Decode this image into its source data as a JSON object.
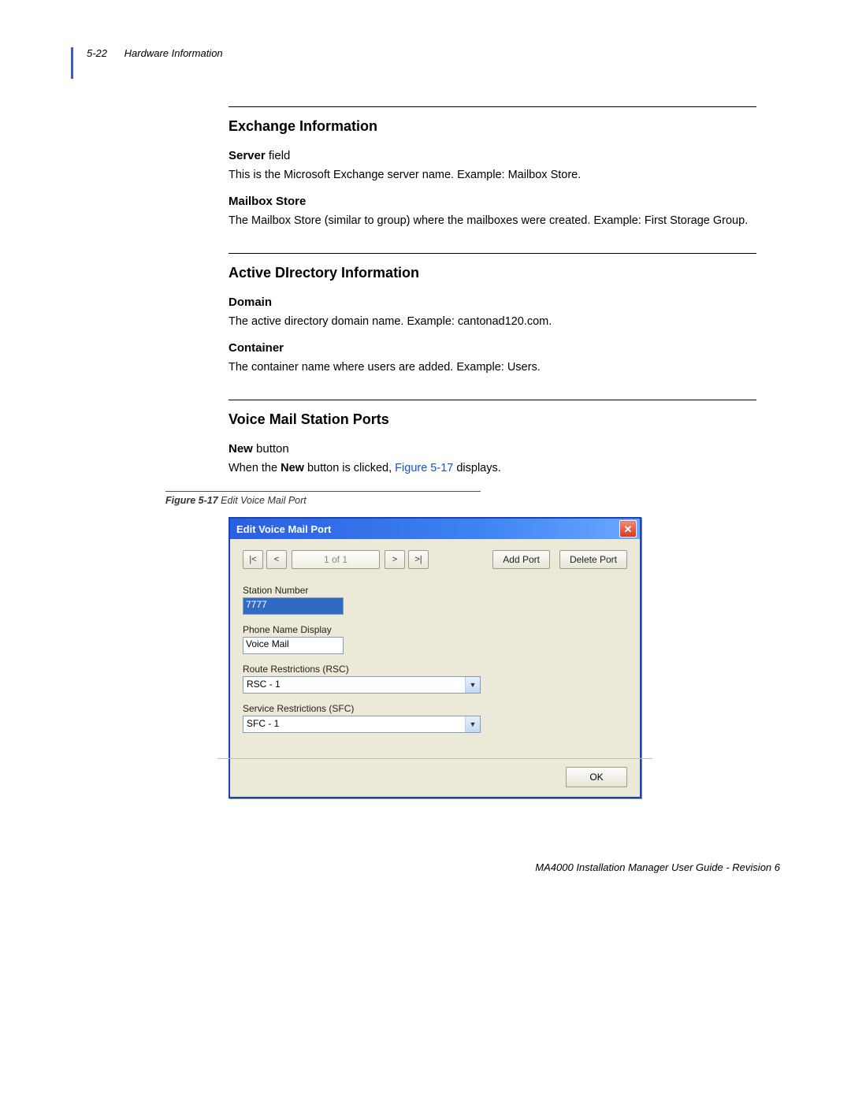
{
  "header": {
    "pageno": "5-22",
    "title": "Hardware Information"
  },
  "sections": {
    "exchange": {
      "title": "Exchange Information",
      "server_label": "Server",
      "server_suffix": " field",
      "server_desc": "This is the Microsoft Exchange server name. Example: Mailbox Store.",
      "mailbox_label": "Mailbox Store",
      "mailbox_desc": "The Mailbox Store (similar to group) where the mailboxes were created. Example: First Storage Group."
    },
    "ad": {
      "title": "Active DIrectory Information",
      "domain_label": "Domain",
      "domain_desc": "The active directory domain name. Example: cantonad120.com.",
      "container_label": "Container",
      "container_desc": "The container name where users are added. Example: Users."
    },
    "vm": {
      "title": "Voice Mail Station Ports",
      "new_label": "New",
      "new_suffix": " button",
      "new_desc_pre": "When the ",
      "new_desc_bold": "New",
      "new_desc_mid": " button is clicked, ",
      "new_desc_link": "Figure 5-17",
      "new_desc_post": " displays."
    }
  },
  "figure": {
    "caption_b": "Figure 5-17",
    "caption_t": "  Edit Voice Mail Port"
  },
  "dialog": {
    "title": "Edit Voice Mail Port",
    "nav_first": "|<",
    "nav_prev": "<",
    "nav_count": "1 of 1",
    "nav_next": ">",
    "nav_last": ">|",
    "add_port": "Add Port",
    "delete_port": "Delete Port",
    "station_label": "Station Number",
    "station_value": "7777",
    "phone_label": "Phone Name Display",
    "phone_value": "Voice Mail",
    "rsc_label": "Route Restrictions (RSC)",
    "rsc_value": "RSC - 1",
    "sfc_label": "Service Restrictions (SFC)",
    "sfc_value": "SFC - 1",
    "ok": "OK"
  },
  "footer": "MA4000 Installation Manager User Guide - Revision 6"
}
